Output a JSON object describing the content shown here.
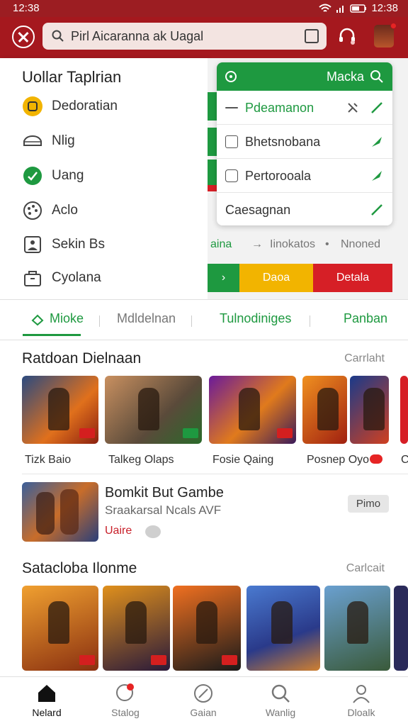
{
  "status": {
    "time": "12:38",
    "right_time": "12:38"
  },
  "search": {
    "value": "Pirl Aicaranna ak Uagal"
  },
  "left_menu": {
    "title": "Uollar Taplrian",
    "items": [
      {
        "label": "Dedoratian",
        "icon": "coin-icon"
      },
      {
        "label": "Nlig",
        "icon": "car-icon"
      },
      {
        "label": "Uang",
        "icon": "badge-icon"
      },
      {
        "label": "Aclo",
        "icon": "palette-icon"
      },
      {
        "label": "Sekin Bs",
        "icon": "image-icon"
      },
      {
        "label": "Cyolana",
        "icon": "bag-icon"
      }
    ]
  },
  "dropdown": {
    "header": "Macka",
    "items": [
      "Pdeamanon",
      "Bhetsnobana",
      "Pertorooala",
      "Caesagnan"
    ]
  },
  "filters": {
    "a": "aina",
    "b": "Iinokatos",
    "c": "Nnoned"
  },
  "buttons": {
    "yellow": "Daoa",
    "red": "Detala"
  },
  "tabs": [
    "Mioke",
    "Mdldelnan",
    "Tulnodiniges",
    "Panban"
  ],
  "section1": {
    "title": "Ratdoan Dielnaan",
    "link": "Carrlaht",
    "cards": [
      "Tizk Baio",
      "Talkeg Olaps",
      "Fosie Qaing",
      "Posnep Oyo",
      "C"
    ]
  },
  "featured": {
    "title": "Bomkit But Gambe",
    "subtitle": "Sraakarsal Ncals AVF",
    "tag": "Uaire",
    "button": "Pimo"
  },
  "section2": {
    "title": "Satacloba Ilonme",
    "link": "Carlcait"
  },
  "nav": [
    {
      "label": "Nelard",
      "icon": "home-icon"
    },
    {
      "label": "Stalog",
      "icon": "tag-icon"
    },
    {
      "label": "Gaian",
      "icon": "compass-icon"
    },
    {
      "label": "Wanlig",
      "icon": "search-icon"
    },
    {
      "label": "Dloalk",
      "icon": "user-icon"
    }
  ],
  "colors": {
    "brand_red": "#a5181e",
    "green": "#1e9940",
    "yellow": "#f2b400",
    "red_btn": "#d61f26"
  }
}
